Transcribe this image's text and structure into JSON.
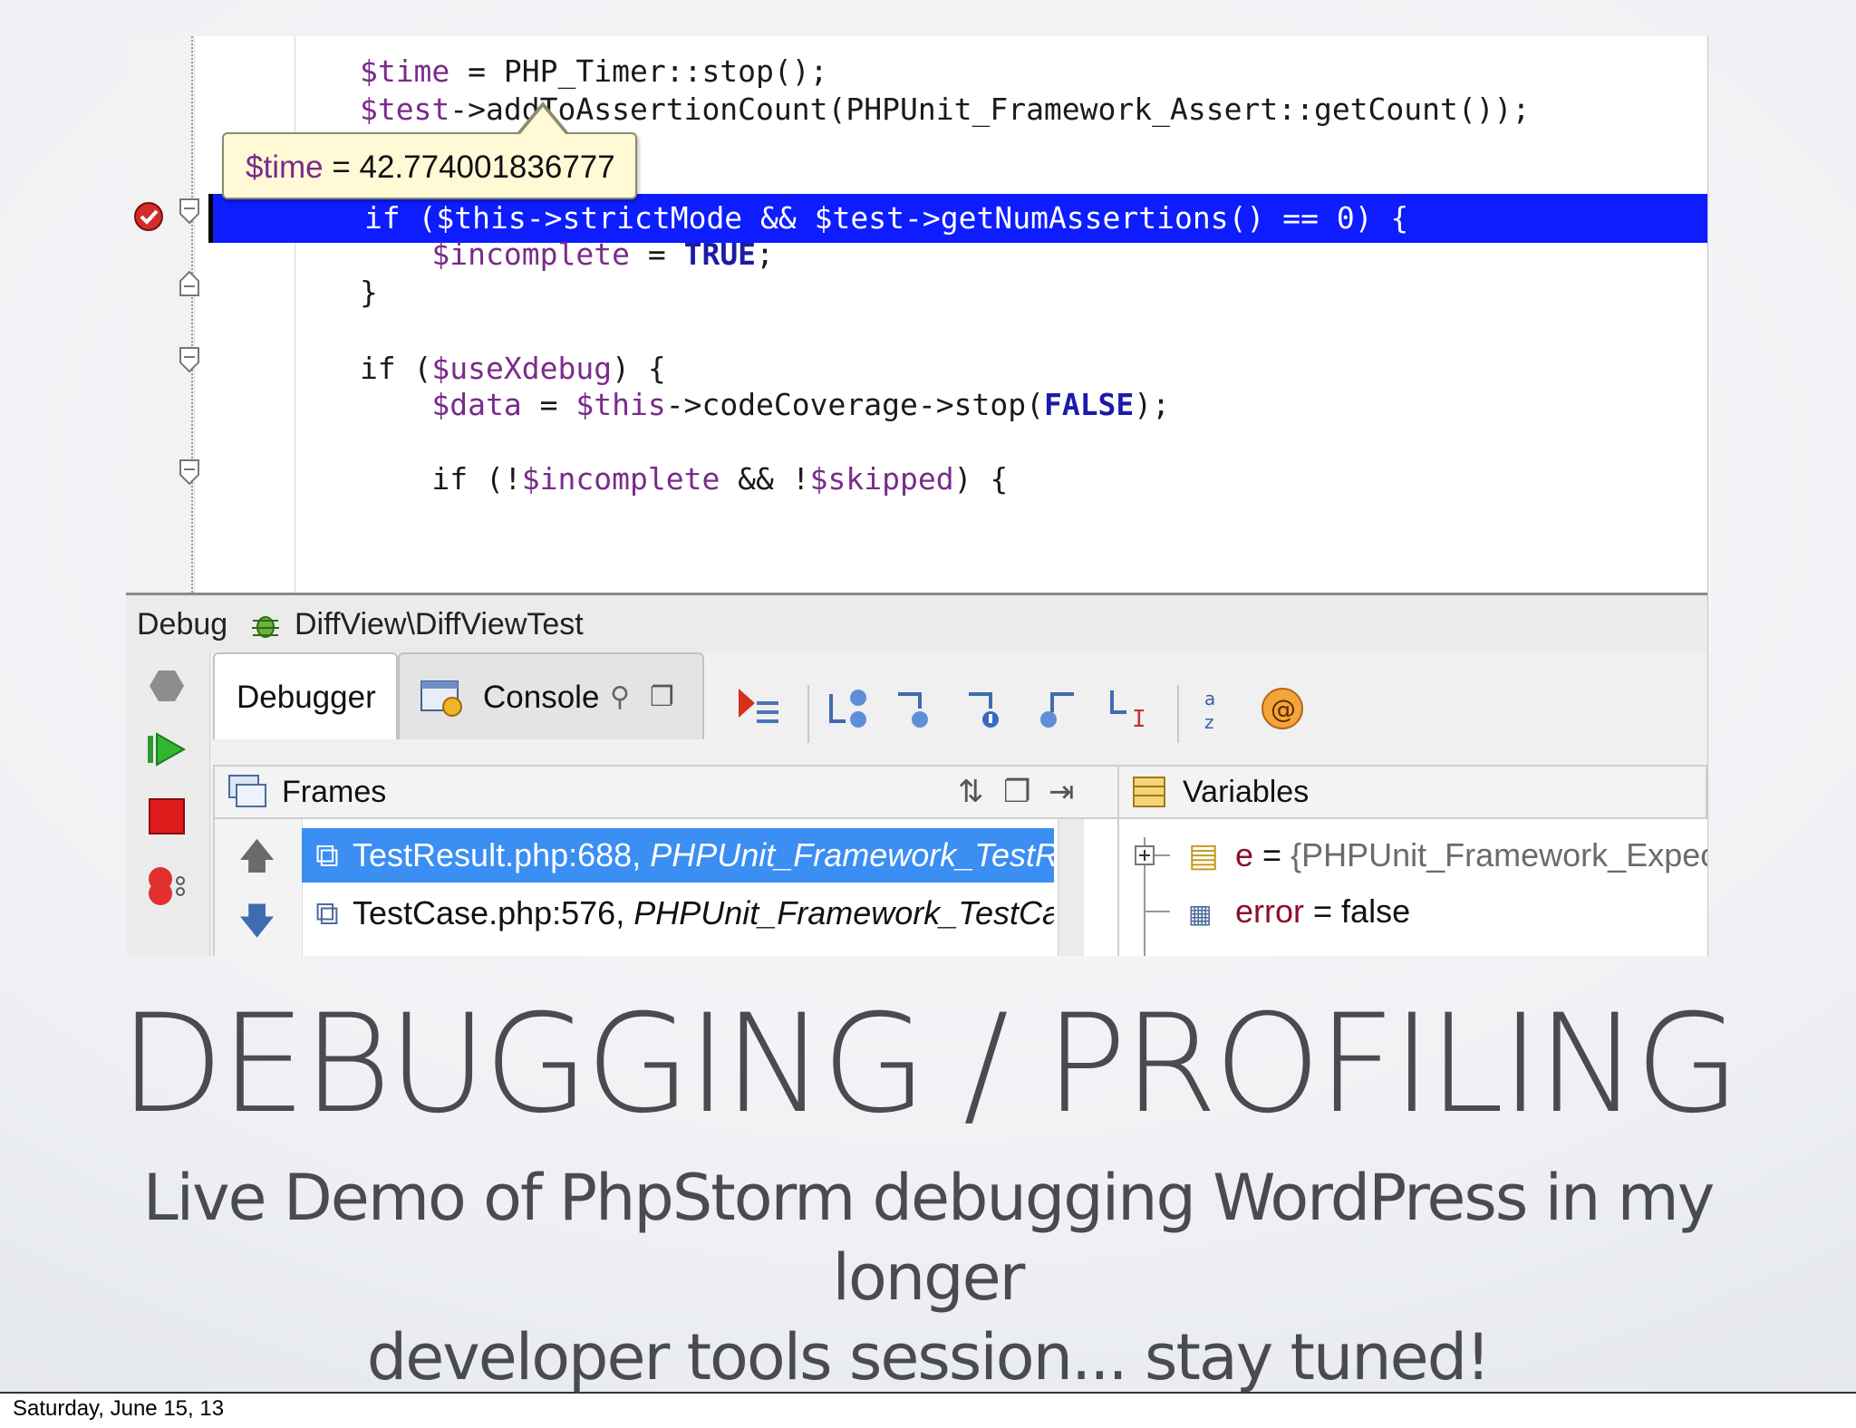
{
  "editor": {
    "lines": [
      {
        "parts": [
          {
            "t": "        "
          },
          {
            "t": "$time",
            "c": "v"
          },
          {
            "t": " = PHP_Timer::stop();"
          }
        ]
      },
      {
        "parts": [
          {
            "t": "        "
          },
          {
            "t": "$test",
            "c": "v"
          },
          {
            "t": "->addToAssertionCount(PHPUnit_Framework_Assert::getCount());"
          }
        ]
      },
      {
        "parts": [
          {
            "t": "        if ("
          },
          {
            "t": "$this",
            "c": "v"
          },
          {
            "t": "->strictMode && "
          },
          {
            "t": "$test",
            "c": "v"
          },
          {
            "t": "->getNumAssertions() == 0) {"
          }
        ]
      },
      {
        "parts": [
          {
            "t": "            "
          },
          {
            "t": "$incomplete",
            "c": "v"
          },
          {
            "t": " = "
          },
          {
            "t": "TRUE",
            "c": "k"
          },
          {
            "t": ";"
          }
        ]
      },
      {
        "parts": [
          {
            "t": "        }"
          }
        ]
      },
      {
        "parts": [
          {
            "t": ""
          }
        ]
      },
      {
        "parts": [
          {
            "t": "        if ("
          },
          {
            "t": "$useXdebug",
            "c": "v"
          },
          {
            "t": ") {"
          }
        ]
      },
      {
        "parts": [
          {
            "t": "            "
          },
          {
            "t": "$data",
            "c": "v"
          },
          {
            "t": " = "
          },
          {
            "t": "$this",
            "c": "v"
          },
          {
            "t": "->codeCoverage->stop("
          },
          {
            "t": "FALSE",
            "c": "k"
          },
          {
            "t": ");"
          }
        ]
      },
      {
        "parts": [
          {
            "t": ""
          }
        ]
      },
      {
        "parts": [
          {
            "t": "            if (!"
          },
          {
            "t": "$incomplete",
            "c": "v"
          },
          {
            "t": " && !"
          },
          {
            "t": "$skipped",
            "c": "v"
          },
          {
            "t": ") {"
          }
        ]
      }
    ],
    "tooltip": {
      "var": "$time",
      "rest": " = 42.774001836777"
    }
  },
  "debug": {
    "label": "Debug",
    "session": "DiffView\\DiffViewTest",
    "tabs": {
      "debugger": "Debugger",
      "console": "Console"
    },
    "frames": {
      "title": "Frames",
      "rows": [
        {
          "file": "TestResult.php:688, ",
          "cls": "PHPUnit_Framework_TestResult"
        },
        {
          "file": "TestCase.php:576, ",
          "cls": "PHPUnit_Framework_TestCase"
        }
      ]
    },
    "variables": {
      "title": "Variables",
      "rows": [
        {
          "name": "e",
          "eq": " = ",
          "value": "{PHPUnit_Framework_ExpectationFailedException}"
        },
        {
          "name": "error",
          "eq": " = ",
          "value": "false"
        }
      ]
    }
  },
  "slide": {
    "title": "DEBUGGING / PROFILING",
    "subtitle_line1": "Live Demo of PhpStorm debugging WordPress in my longer",
    "subtitle_line2": "developer tools session... stay tuned!",
    "footer": "Saturday, June 15, 13"
  },
  "colors": {
    "highlight": "#0d1dff",
    "selection": "#3b8ef2",
    "variable": "#7a2b8b",
    "keyword": "#1b1ba8",
    "title_text": "#4a4b4f"
  },
  "icons": [
    "breakpoint-icon",
    "fold-icon",
    "bug-icon",
    "resume-icon",
    "stop-icon",
    "step-icons",
    "sort-icon",
    "watch-icon"
  ]
}
